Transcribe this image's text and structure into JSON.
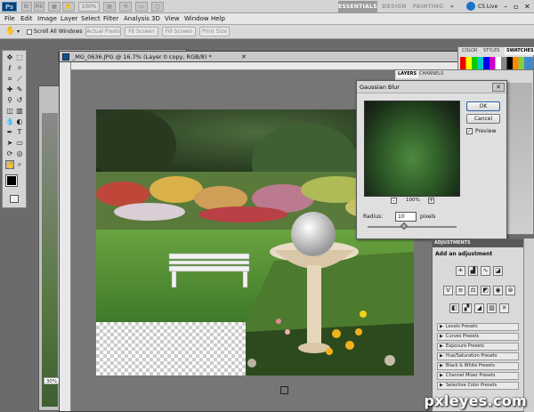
{
  "app": {
    "badge": "Ps",
    "zoom": "100%"
  },
  "workspace": {
    "active": "ESSENTIALS",
    "others": [
      "DESIGN",
      "PAINTING"
    ],
    "more": "»",
    "cslive": "CS Live"
  },
  "menu": [
    "File",
    "Edit",
    "Image",
    "Layer",
    "Select",
    "Filter",
    "Analysis",
    "3D",
    "View",
    "Window",
    "Help"
  ],
  "options": {
    "scroll_all": "Scroll All Windows",
    "buttons": [
      "Actual Pixels",
      "Fit Screen",
      "Fill Screen",
      "Print Size"
    ]
  },
  "document": {
    "tab_title": "_MG_0636.JPG @ 16.7% (Layer 0 copy, RGB/8) *",
    "zoom_label": "30%"
  },
  "panels": {
    "color_tabs": [
      "COLOR",
      "STYLES",
      "SWATCHES"
    ],
    "layer_tabs": [
      "LAYERS",
      "CHANNELS"
    ],
    "adjustments_tab": "ADJUSTMENTS",
    "adjustments_title": "Add an adjustment",
    "presets": [
      "Levels Presets",
      "Curves Presets",
      "Exposure Presets",
      "Hue/Saturation Presets",
      "Black & White Presets",
      "Channel Mixer Presets",
      "Selective Color Presets"
    ]
  },
  "dialog": {
    "title": "Gaussian Blur",
    "ok": "OK",
    "cancel": "Cancel",
    "preview_label": "Preview",
    "preview_checked": true,
    "zoom": "100%",
    "radius_label": "Radius:",
    "radius_value": "10",
    "radius_unit": "pixels"
  },
  "watermark": "pxleyes.com",
  "colors": {
    "accent": "#2c5fa8",
    "appbar": "#d4d4d4",
    "canvas_bg": "#767676"
  }
}
